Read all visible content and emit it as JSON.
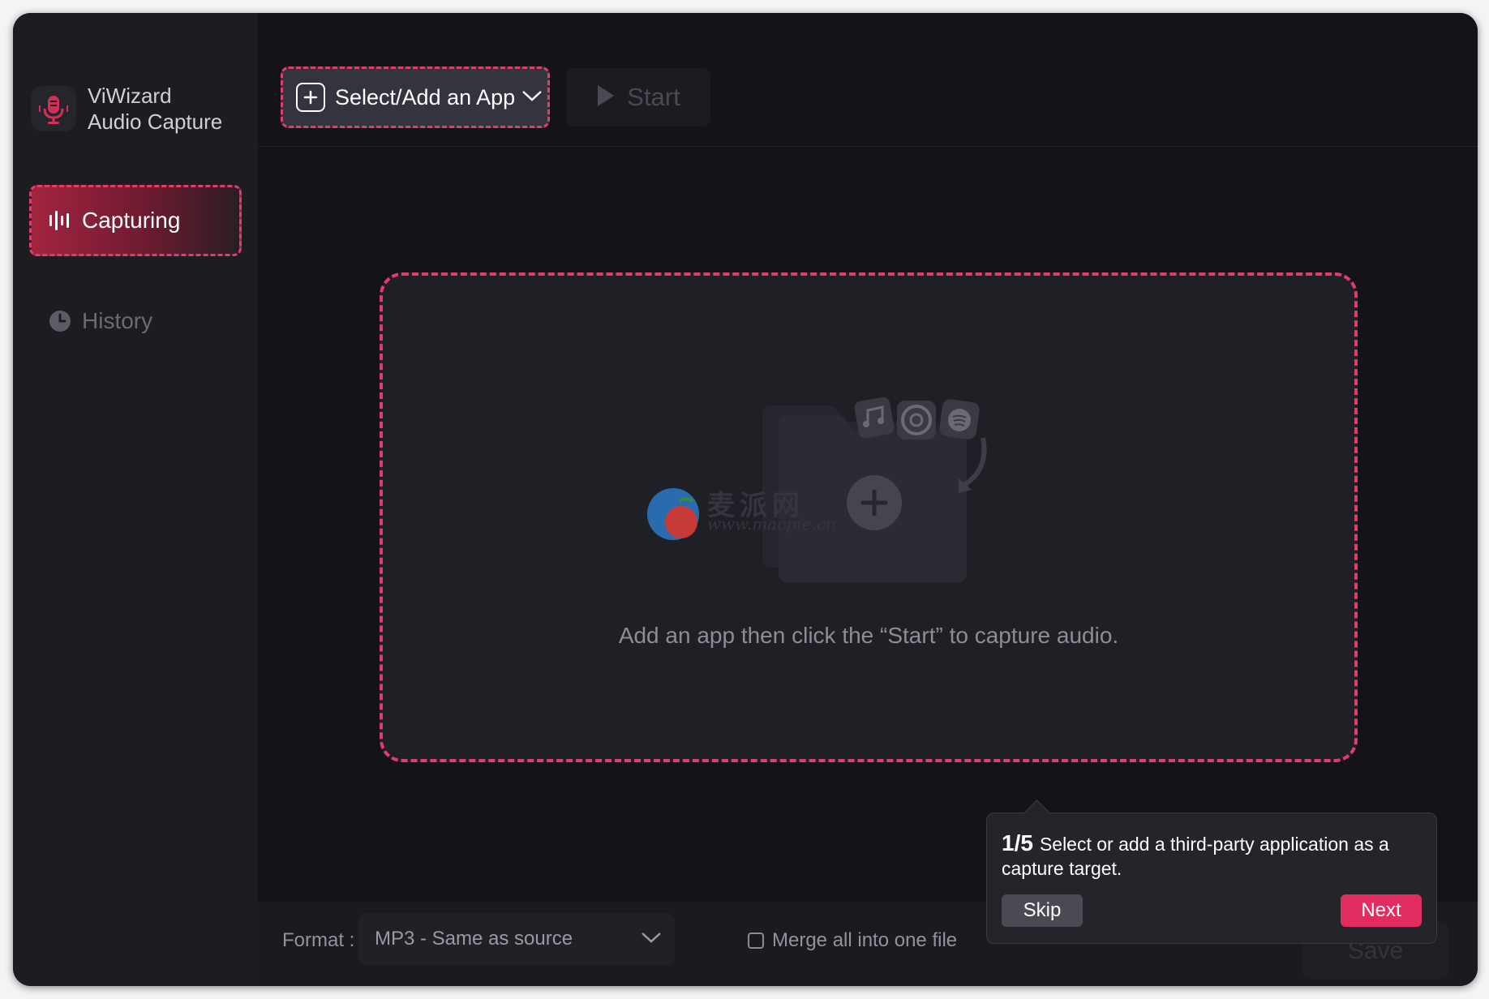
{
  "app": {
    "name_line1": "ViWizard",
    "name_line2": "Audio Capture",
    "accent_color": "#e23c6a"
  },
  "sidebar": {
    "items": [
      {
        "label": "Capturing",
        "icon": "waveform-icon",
        "active": true
      },
      {
        "label": "History",
        "icon": "clock-icon",
        "active": false
      }
    ]
  },
  "toolbar": {
    "select_label": "Select/Add an App",
    "start_label": "Start"
  },
  "dropzone": {
    "hint": "Add an app then click the “Start” to capture audio.",
    "app_icons": [
      "music-note-icon",
      "chrome-icon",
      "spotify-icon"
    ]
  },
  "watermark": {
    "cn": "麦派网",
    "url": "www.macpie.cn"
  },
  "bottom": {
    "format_label": "Format :",
    "format_value": "MP3 - Same as source",
    "merge_label": "Merge all into one file",
    "merge_checked": false,
    "save_label": "Save"
  },
  "tooltip": {
    "step": "1/5",
    "text": "Select or add a third-party application as a capture target.",
    "skip_label": "Skip",
    "next_label": "Next"
  }
}
